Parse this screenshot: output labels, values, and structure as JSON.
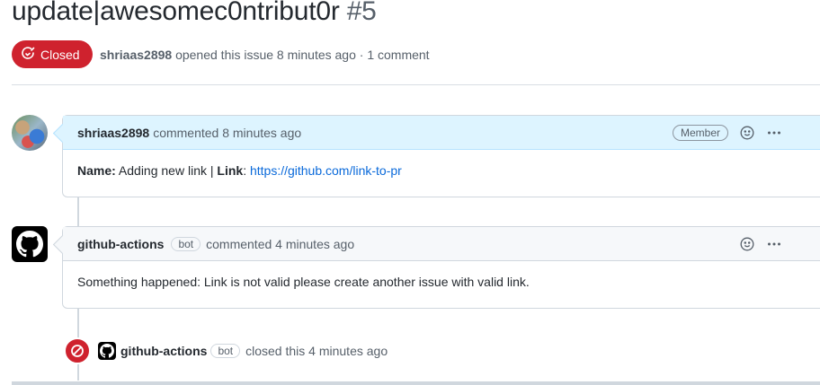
{
  "issue": {
    "title": "update|awesomec0ntribut0r",
    "number": "#5",
    "state": "Closed",
    "author": "shriaas2898",
    "opened_text": "opened this issue 8 minutes ago · 1 comment"
  },
  "comments": [
    {
      "author": "shriaas2898",
      "action": "commented 8 minutes ago",
      "role": "Member",
      "body": {
        "name_label": "Name:",
        "name_value": " Adding new link | ",
        "link_label": "Link",
        "link_sep": ": ",
        "link_url": "https://github.com/link-to-pr"
      }
    },
    {
      "author": "github-actions",
      "bot_label": "bot",
      "action": "commented 4 minutes ago",
      "body": "Something happened: Link is not valid please create another issue with valid link."
    }
  ],
  "event": {
    "actor": "github-actions",
    "bot_label": "bot",
    "action": "closed this 4 minutes ago"
  },
  "colors": {
    "closed": "#cf222e",
    "link": "#0969da",
    "member_header": "#ddf4ff"
  }
}
